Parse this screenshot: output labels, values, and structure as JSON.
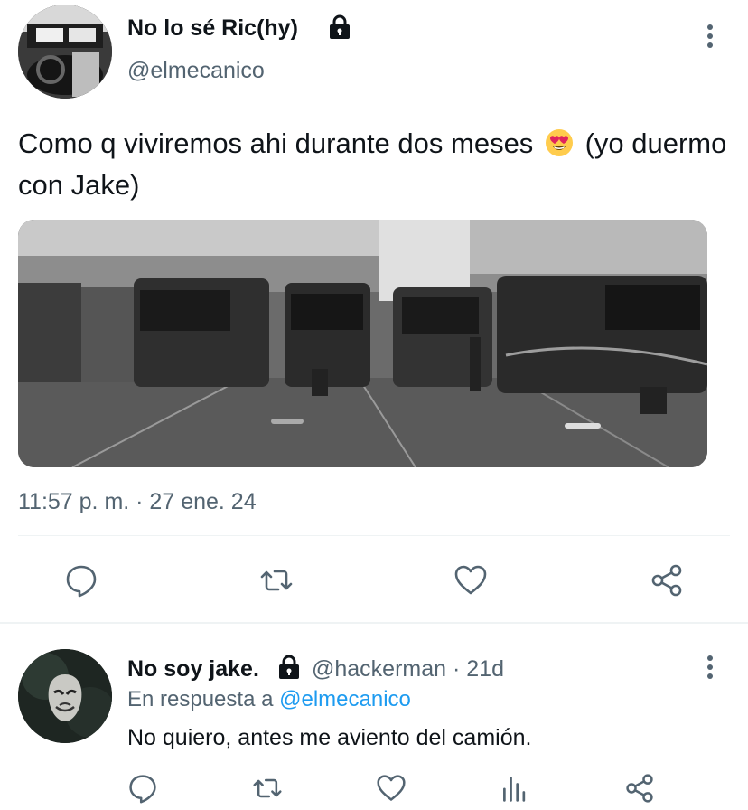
{
  "tweet": {
    "display_name": "No lo sé Ric(hy)",
    "handle": "@elmecanico",
    "text_main": "Como q viviremos ahi durante dos meses",
    "text_tail": "(yo duermo con Jake)",
    "emoji": "heart-eyes-emoji",
    "media_description_icon": "photo",
    "timestamp": "11:57 p. m. · 27 ene. 24"
  },
  "actions": {
    "reply": "reply-icon",
    "retweet": "retweet-icon",
    "like": "heart-icon",
    "share": "share-icon"
  },
  "reply": {
    "display_name": "No soy jake.",
    "meta": "@hackerman · 21d",
    "reply_prefix": "En respuesta a",
    "reply_mention": "@elmecanico",
    "text": "No quiero, antes me aviento del camión."
  },
  "colors": {
    "text": "#0f1419",
    "secondary": "#536471",
    "accent": "#1d9bf0",
    "divider": "#eff3f4"
  }
}
